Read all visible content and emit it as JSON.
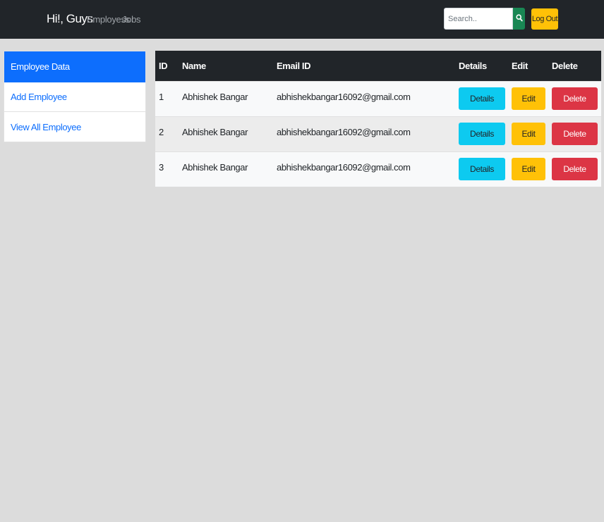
{
  "navbar": {
    "brand": "Hi!, Guys",
    "links": [
      "Employess",
      "Jobs"
    ],
    "search_placeholder": "Search..",
    "search_icon": "search-icon",
    "logout_label": "Log Out"
  },
  "sidebar": {
    "items": [
      {
        "label": "Employee Data",
        "active": true
      },
      {
        "label": "Add Employee",
        "active": false
      },
      {
        "label": "View All Employee",
        "active": false
      }
    ]
  },
  "table": {
    "headers": [
      "ID",
      "Name",
      "Email ID",
      "Details",
      "Edit",
      "Delete"
    ],
    "rows": [
      {
        "id": "1",
        "name": "Abhishek Bangar",
        "email": "abhishekbangar16092@gmail.com",
        "details": "Details",
        "edit": "Edit",
        "delete": "Delete"
      },
      {
        "id": "2",
        "name": "Abhishek Bangar",
        "email": "abhishekbangar16092@gmail.com",
        "details": "Details",
        "edit": "Edit",
        "delete": "Delete"
      },
      {
        "id": "3",
        "name": "Abhishek Bangar",
        "email": "abhishekbangar16092@gmail.com",
        "details": "Details",
        "edit": "Edit",
        "delete": "Delete"
      }
    ]
  },
  "colors": {
    "navbar_bg": "#212529",
    "primary": "#0d6efd",
    "info": "#0dcaf0",
    "warning": "#ffc107",
    "danger": "#dc3545",
    "success": "#198754",
    "page_bg": "#dcdcdc"
  }
}
